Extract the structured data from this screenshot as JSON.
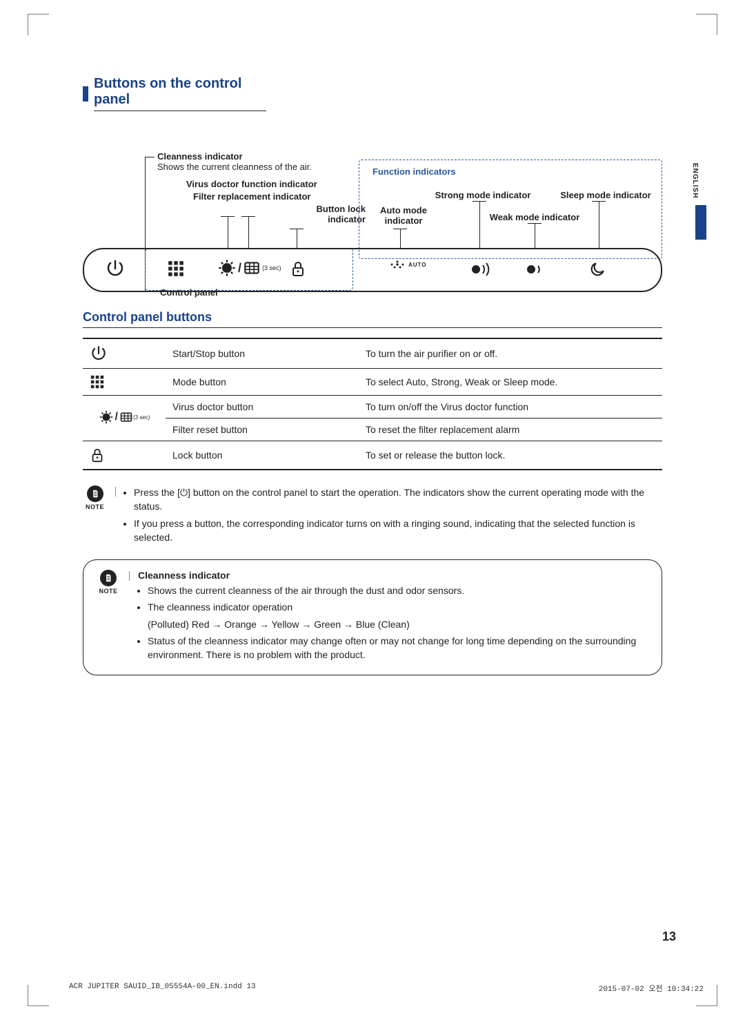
{
  "section_title": "Buttons on the control panel",
  "diagram": {
    "cleanness_title": "Cleanness indicator",
    "cleanness_sub": "Shows the current cleanness of the air.",
    "virus_doctor_label": "Virus doctor function indicator",
    "filter_label": "Filter replacement indicator",
    "btnlock_label1": "Button lock",
    "btnlock_label2": "indicator",
    "control_panel_label": "Control panel",
    "function_indicators": "Function indicators",
    "auto_mode_l1": "Auto mode",
    "auto_mode_l2": "indicator",
    "strong_mode": "Strong mode indicator",
    "weak_mode": "Weak mode indicator",
    "sleep_mode": "Sleep mode indicator",
    "three_sec": "(3 sec)",
    "auto_word": "AUTO"
  },
  "sub_heading": "Control panel buttons",
  "table": [
    {
      "name": "Start/Stop button",
      "desc": "To turn the air purifier on or off."
    },
    {
      "name": "Mode button",
      "desc": "To select Auto, Strong, Weak or Sleep mode."
    },
    {
      "name": "Virus doctor button",
      "desc": "To turn on/off the Virus doctor function"
    },
    {
      "name": "Filter reset button",
      "desc": "To reset the filter replacement alarm"
    },
    {
      "name": "Lock button",
      "desc": "To set or release the button lock."
    }
  ],
  "note1": {
    "items": [
      "Press the [⏻] button on the control panel to start the operation. The indicators show the current operating mode with the status.",
      "If you press a button, the corresponding indicator turns on with a ringing sound, indicating that the selected function is selected."
    ]
  },
  "note2": {
    "title": "Cleanness indicator",
    "items": [
      "Shows the current cleanness of the air through the dust and odor sensors.",
      "The cleanness indicator operation",
      "(Polluted) Red → Orange → Yellow → Green → Blue (Clean)",
      "Status of the cleanness indicator may change often or may not change for long time depending on the surrounding environment. There is no problem with the product."
    ]
  },
  "language_tab": "ENGLISH",
  "page_number": "13",
  "footer_left": "ACR JUPITER SAUID_IB_05554A-00_EN.indd   13",
  "footer_right": "2015-07-02   오전 10:34:22",
  "note_word": "NOTE"
}
